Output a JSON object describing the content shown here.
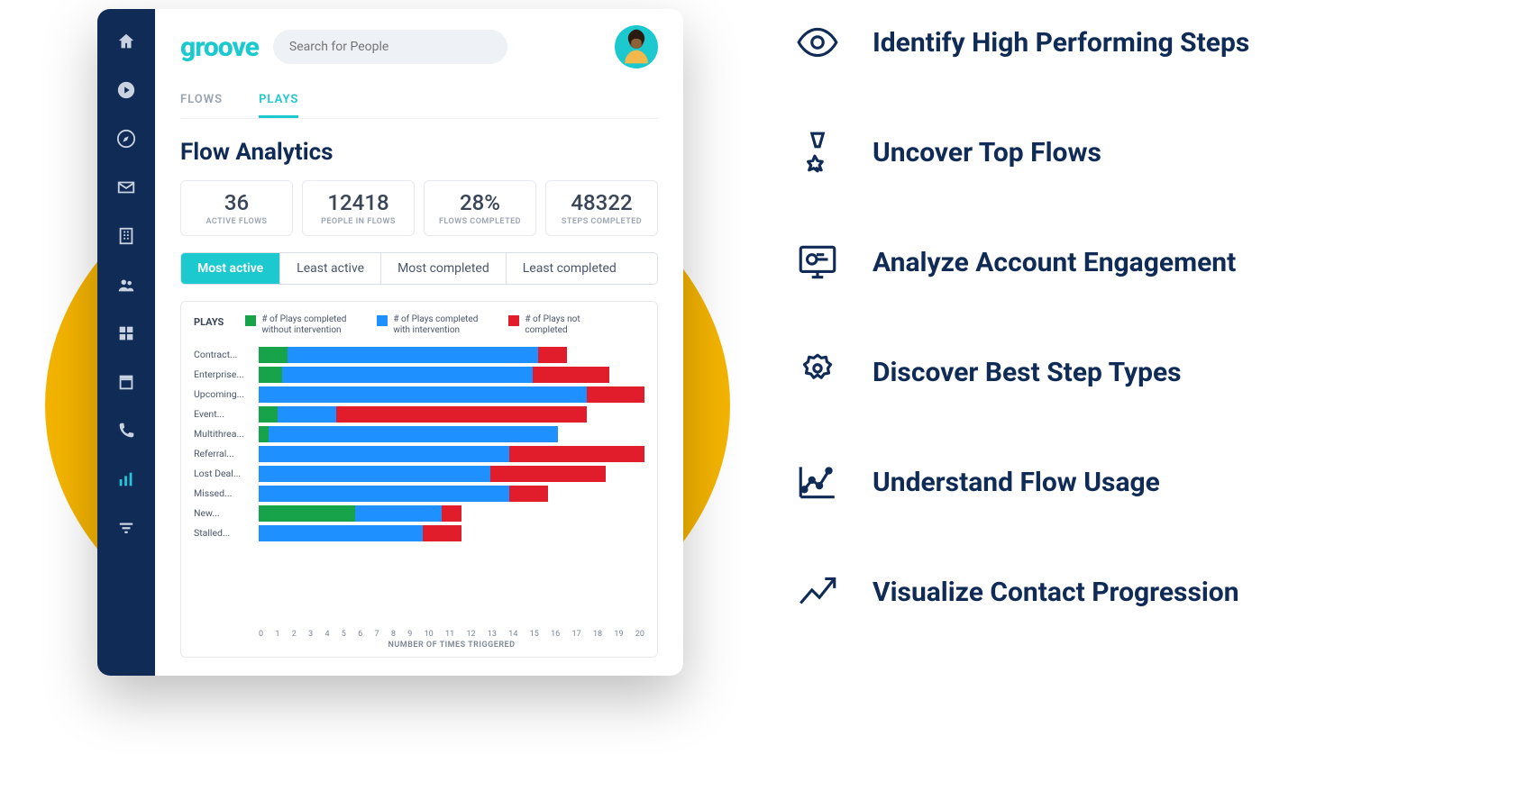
{
  "brand": "groove",
  "colors": {
    "accent": "#1bc9cf",
    "navy": "#0f2b56",
    "yellow": "#f4b400",
    "green": "#16a34a",
    "blue": "#1e90ff",
    "red": "#e11d2b"
  },
  "search": {
    "placeholder": "Search for People"
  },
  "tabs": {
    "flows": "FLOWS",
    "plays": "PLAYS"
  },
  "active_tab": "plays",
  "page_title": "Flow Analytics",
  "metrics": [
    {
      "value": "36",
      "label": "ACTIVE FLOWS"
    },
    {
      "value": "12418",
      "label": "PEOPLE IN FLOWS"
    },
    {
      "value": "28%",
      "label": "FLOWS COMPLETED"
    },
    {
      "value": "48322",
      "label": "STEPS COMPLETED"
    }
  ],
  "filters": [
    {
      "label": "Most active",
      "active": true
    },
    {
      "label": "Least active",
      "active": false
    },
    {
      "label": "Most completed",
      "active": false
    },
    {
      "label": "Least completed",
      "active": false
    }
  ],
  "chart": {
    "title": "PLAYS",
    "legend": [
      {
        "text": "# of Plays completed without intervention",
        "color": "#16a34a"
      },
      {
        "text": "# of Plays completed with intervention",
        "color": "#1e90ff"
      },
      {
        "text": "# of Plays not completed",
        "color": "#e11d2b"
      }
    ],
    "x_label": "NUMBER OF TIMES TRIGGERED",
    "x_max": 20,
    "x_ticks": [
      0,
      1,
      2,
      3,
      4,
      5,
      6,
      7,
      8,
      9,
      10,
      11,
      12,
      13,
      14,
      15,
      16,
      17,
      18,
      19,
      20
    ]
  },
  "chart_data": {
    "type": "bar",
    "orientation": "horizontal",
    "stacked": true,
    "xlabel": "NUMBER OF TIMES TRIGGERED",
    "ylabel": "",
    "xlim": [
      0,
      20
    ],
    "categories": [
      "Contract...",
      "Enterprise...",
      "Upcoming...",
      "Event...",
      "Multithrea...",
      "Referral...",
      "Lost Deal...",
      "Missed...",
      "New...",
      "Stalled..."
    ],
    "series": [
      {
        "name": "# of Plays completed without intervention",
        "color": "#16a34a",
        "values": [
          1.5,
          1.2,
          0,
          1,
          0.5,
          0,
          0,
          0,
          5,
          0
        ]
      },
      {
        "name": "# of Plays completed with intervention",
        "color": "#1e90ff",
        "values": [
          13,
          13,
          17,
          3,
          15,
          13,
          12,
          13,
          4.5,
          8.5
        ]
      },
      {
        "name": "# of Plays not completed",
        "color": "#e11d2b",
        "values": [
          1.5,
          4,
          3,
          13,
          0,
          7,
          6,
          2,
          1,
          2
        ]
      }
    ]
  },
  "sidebar_icons": [
    "home",
    "play",
    "explore",
    "mail",
    "building",
    "people",
    "grid",
    "archive",
    "phone",
    "analytics",
    "filter"
  ],
  "active_sidebar": "analytics",
  "features": [
    {
      "icon": "eye",
      "text": "Identify High Performing Steps"
    },
    {
      "icon": "medal",
      "text": "Uncover Top Flows"
    },
    {
      "icon": "monitor",
      "text": "Analyze Account Engagement"
    },
    {
      "icon": "ribbon",
      "text": "Discover Best Step Types"
    },
    {
      "icon": "linechart",
      "text": "Understand Flow Usage"
    },
    {
      "icon": "trend",
      "text": "Visualize Contact Progression"
    }
  ]
}
